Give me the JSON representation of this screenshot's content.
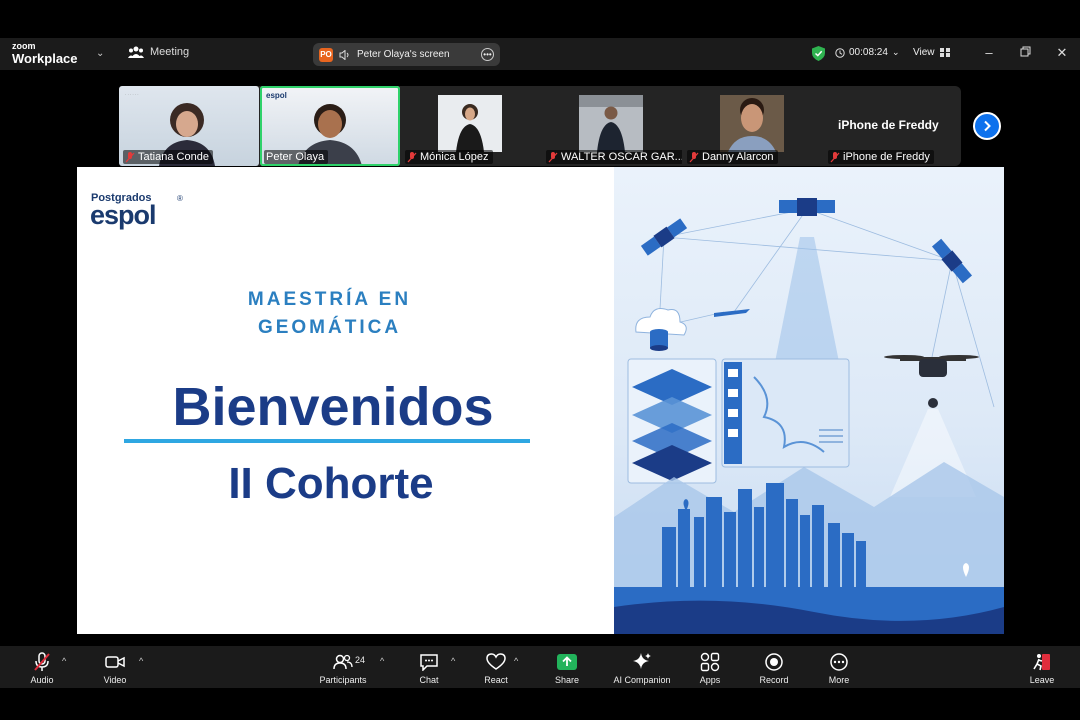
{
  "app": {
    "brand_top": "zoom",
    "brand_name": "Workplace"
  },
  "titlebar": {
    "meeting_label": "Meeting",
    "screen_badge": "PO",
    "screen_label": "Peter Olaya's screen",
    "timer": "00:08:24",
    "view_label": "View"
  },
  "participants_strip": [
    {
      "name": "Tatiana Conde"
    },
    {
      "name": "Peter Olaya"
    },
    {
      "name": "Mónica López"
    },
    {
      "name": "WALTER OSCAR GAR..."
    },
    {
      "name": "Danny Alarcon"
    },
    {
      "name": "iPhone de Freddy",
      "title": "iPhone de Freddy"
    }
  ],
  "slide": {
    "logo_top": "Postgrados",
    "logo_main": "espol",
    "logo_reg": "®",
    "program_line1": "MAESTRÍA EN",
    "program_line2": "GEOMÁTICA",
    "headline": "Bienvenidos",
    "subheadline": "II Cohorte"
  },
  "toolbar": {
    "audio": "Audio",
    "video": "Video",
    "participants": "Participants",
    "participants_count": "24",
    "chat": "Chat",
    "react": "React",
    "share": "Share",
    "ai_companion": "AI Companion",
    "apps": "Apps",
    "record": "Record",
    "more": "More",
    "leave": "Leave"
  },
  "colors": {
    "accent_green": "#2fd26a",
    "share_green": "#22b35b",
    "leave_red": "#e02d3c",
    "zoom_blue": "#0e72ed",
    "slide_navy": "#1b3c87",
    "slide_blue": "#2b7fc0"
  }
}
